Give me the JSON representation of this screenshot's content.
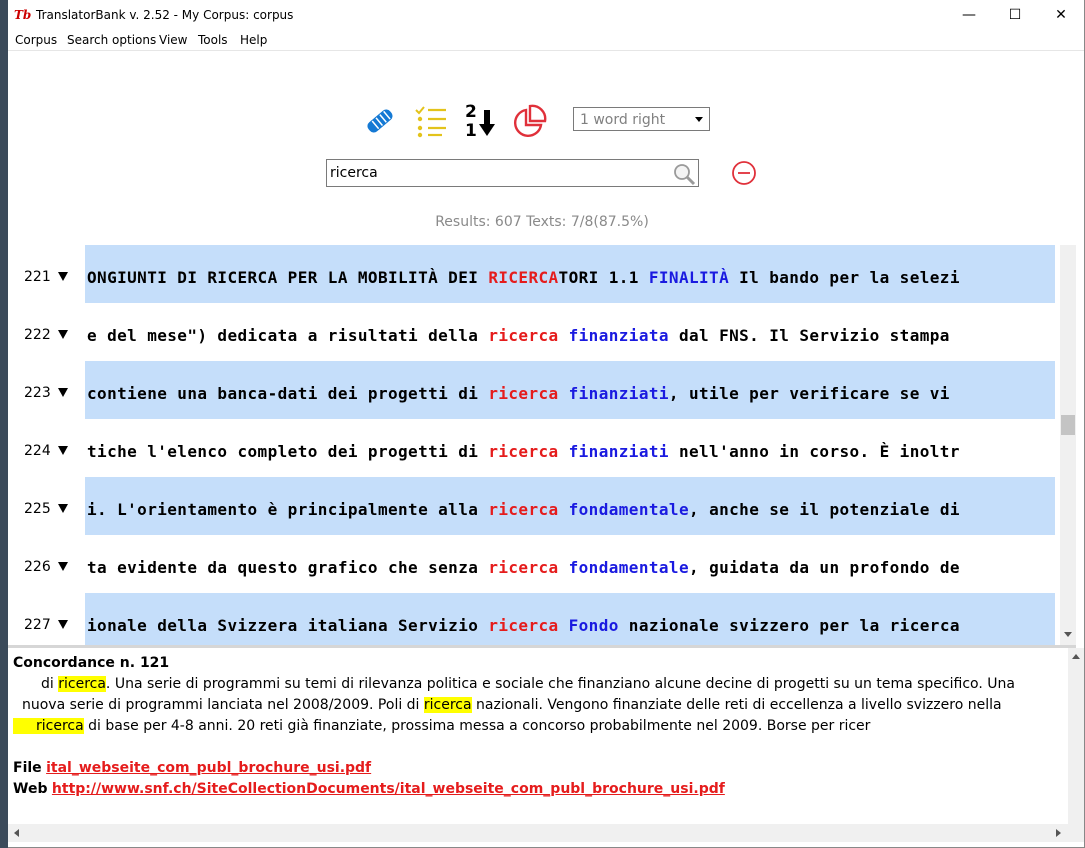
{
  "window": {
    "title": "TranslatorBank v. 2.52 - My Corpus: corpus",
    "app_icon": "Tb",
    "minimize": "—",
    "maximize": "☐",
    "close": "✕"
  },
  "menu": {
    "items": [
      {
        "label": "Corpus"
      },
      {
        "label": "Search options"
      },
      {
        "label": "View"
      },
      {
        "label": "Tools"
      },
      {
        "label": "Help"
      }
    ]
  },
  "toolbar": {
    "icons": [
      "handshake-icon",
      "list-icon",
      "sort-icon",
      "pie-chart-icon"
    ],
    "sort_top": "2",
    "sort_bottom": "1",
    "context_selected": "1 word right",
    "colors": {
      "blue": "#1479d4",
      "yellow": "#e3c31b",
      "red": "#e0303a"
    }
  },
  "search": {
    "value": "ricerca",
    "icons": [
      "search-icon",
      "remove-icon"
    ]
  },
  "results": {
    "text": "Results: 607 Texts: 7/8(87.5%)"
  },
  "rows": [
    {
      "num": "221",
      "bg": "#c5defa",
      "pre": "ONGIUNTI DI RICERCA PER LA MOBILITÀ DEI ",
      "match": "RICERCA",
      "mid": "TORI 1.1 ",
      "coll": "FINALITÀ",
      "post": " Il bando per la selezi"
    },
    {
      "num": "222",
      "bg": "#ffffff",
      "pre": "e del mese\") dedicata a risultati della ",
      "match": "ricerca",
      "mid": " ",
      "coll": "finanziata",
      "post": " dal FNS. Il Servizio stampa"
    },
    {
      "num": "223",
      "bg": "#c5defa",
      "pre": "contiene una banca-dati dei progetti di ",
      "match": "ricerca",
      "mid": " ",
      "coll": "finanziati",
      "post": ", utile per verificare se vi"
    },
    {
      "num": "224",
      "bg": "#ffffff",
      "pre": "tiche l'elenco completo dei progetti di ",
      "match": "ricerca",
      "mid": " ",
      "coll": "finanziati",
      "post": " nell'anno in corso. È inoltr"
    },
    {
      "num": "225",
      "bg": "#c5defa",
      "pre": "i. L'orientamento è principalmente alla ",
      "match": "ricerca",
      "mid": " ",
      "coll": "fondamentale",
      "post": ", anche se il potenziale di"
    },
    {
      "num": "226",
      "bg": "#ffffff",
      "pre": "ta evidente da questo grafico che senza ",
      "match": "ricerca",
      "mid": " ",
      "coll": "fondamentale",
      "post": ", guidata da un profondo de"
    },
    {
      "num": "227",
      "bg": "#c5defa",
      "pre": "ionale della Svizzera italiana Servizio ",
      "match": "ricerca",
      "mid": " ",
      "coll": "Fondo",
      "post": " nazionale svizzero per la ricerca"
    }
  ],
  "detail": {
    "heading": "Concordance n. 121",
    "line1_a": "di ",
    "line1_hl": "ricerca",
    "line1_b": ". Una serie di programmi su temi di rilevanza politica e sociale che finanziano alcune decine di progetti su un tema specifico. Una",
    "line2_a": "nuova serie di programmi lanciata nel 2008/2009. Poli di ",
    "line2_hl": "ricerca",
    "line2_b": " nazionali. Vengono finanziate delle reti di eccellenza a livello svizzero nella",
    "line3_hl": "ricerca",
    "line3_b": " di base per 4-8 anni. 20 reti già finanziate, prossima messa a concorso probabilmente nel 2009. Borse per ricer",
    "file_label": "File",
    "file_value": "ital_webseite_com_publ_brochure_usi.pdf",
    "web_label": "Web",
    "web_value": "http://www.snf.ch/SiteCollectionDocuments/ital_webseite_com_publ_brochure_usi.pdf"
  }
}
